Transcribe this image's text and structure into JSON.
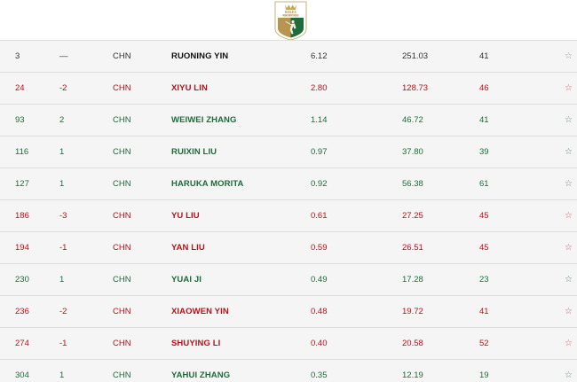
{
  "header": {
    "logo_top_text": "ROLEX",
    "logo_bottom_text": "RANKINGS"
  },
  "colors": {
    "up": "#1d6b3a",
    "down": "#b5121b",
    "neutral": "#333333",
    "logo_gold": "#b8954e",
    "logo_green": "#1f6b3c"
  },
  "favorite_icon": "star-outline-icon",
  "rows": [
    {
      "rank": "3",
      "move": "—",
      "country": "CHN",
      "name": "RUONING YIN",
      "avg": "6.12",
      "total": "251.03",
      "events": "41",
      "star": "☆",
      "trend": "neutral"
    },
    {
      "rank": "24",
      "move": "-2",
      "country": "CHN",
      "name": "XIYU LIN",
      "avg": "2.80",
      "total": "128.73",
      "events": "46",
      "star": "☆",
      "trend": "down"
    },
    {
      "rank": "93",
      "move": "2",
      "country": "CHN",
      "name": "WEIWEI ZHANG",
      "avg": "1.14",
      "total": "46.72",
      "events": "41",
      "star": "☆",
      "trend": "up"
    },
    {
      "rank": "116",
      "move": "1",
      "country": "CHN",
      "name": "RUIXIN LIU",
      "avg": "0.97",
      "total": "37.80",
      "events": "39",
      "star": "☆",
      "trend": "up"
    },
    {
      "rank": "127",
      "move": "1",
      "country": "CHN",
      "name": "HARUKA MORITA",
      "avg": "0.92",
      "total": "56.38",
      "events": "61",
      "star": "☆",
      "trend": "up"
    },
    {
      "rank": "186",
      "move": "-3",
      "country": "CHN",
      "name": "YU LIU",
      "avg": "0.61",
      "total": "27.25",
      "events": "45",
      "star": "☆",
      "trend": "down"
    },
    {
      "rank": "194",
      "move": "-1",
      "country": "CHN",
      "name": "YAN LIU",
      "avg": "0.59",
      "total": "26.51",
      "events": "45",
      "star": "☆",
      "trend": "down"
    },
    {
      "rank": "230",
      "move": "1",
      "country": "CHN",
      "name": "YUAI JI",
      "avg": "0.49",
      "total": "17.28",
      "events": "23",
      "star": "☆",
      "trend": "up"
    },
    {
      "rank": "236",
      "move": "-2",
      "country": "CHN",
      "name": "XIAOWEN YIN",
      "avg": "0.48",
      "total": "19.72",
      "events": "41",
      "star": "☆",
      "trend": "down"
    },
    {
      "rank": "274",
      "move": "-1",
      "country": "CHN",
      "name": "SHUYING LI",
      "avg": "0.40",
      "total": "20.58",
      "events": "52",
      "star": "☆",
      "trend": "down"
    },
    {
      "rank": "304",
      "move": "1",
      "country": "CHN",
      "name": "YAHUI ZHANG",
      "avg": "0.35",
      "total": "12.19",
      "events": "19",
      "star": "☆",
      "trend": "up"
    }
  ]
}
